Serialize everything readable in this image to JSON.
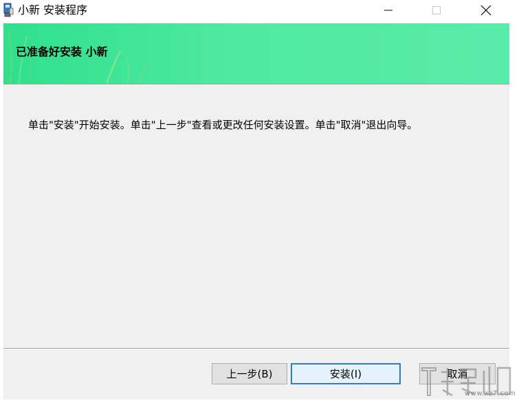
{
  "window": {
    "title": "小新 安装程序",
    "controls": {
      "minimize_icon": "minimize-icon",
      "maximize_icon": "maximize-icon",
      "close_icon": "close-icon"
    }
  },
  "banner": {
    "title": "已准备好安装 小新"
  },
  "content": {
    "description": "单击\"安装\"开始安装。单击\"上一步\"查看或更改任何安装设置。单击\"取消\"退出向导。"
  },
  "buttons": {
    "back": "上一步(B)",
    "install": "安装(I)",
    "cancel": "取消"
  },
  "watermark": {
    "text": "www.xz7.com"
  },
  "colors": {
    "banner_start": "#2fe08c",
    "banner_end": "#58ecaa",
    "dialog_bg": "#f0f0f0",
    "focus_border": "#2d7bd1"
  }
}
